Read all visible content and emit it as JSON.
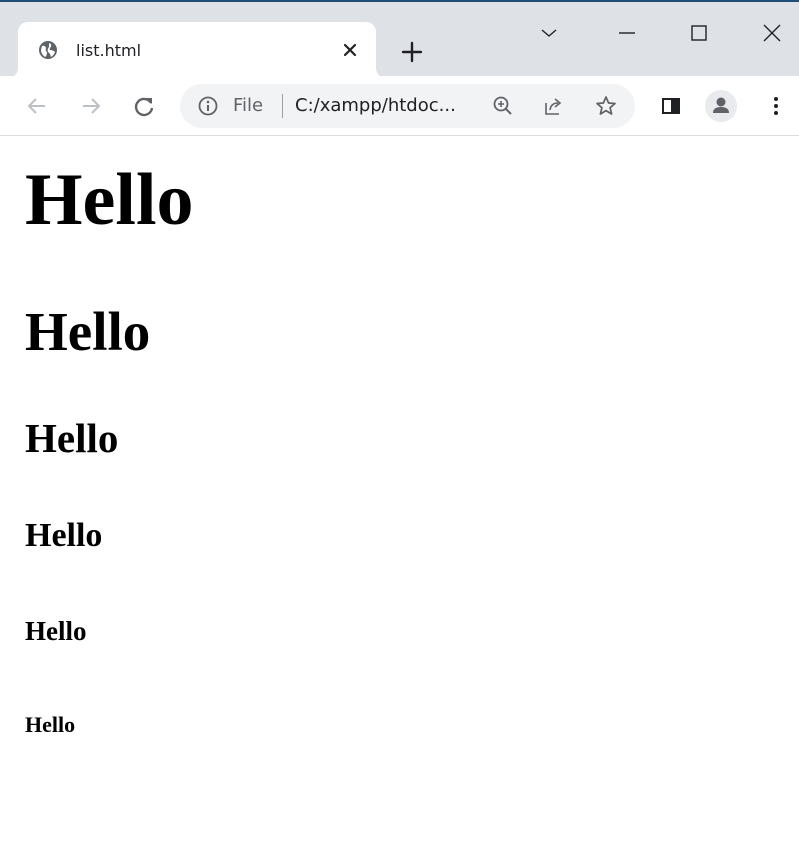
{
  "browser": {
    "tab": {
      "title": "list.html",
      "favicon": "globe-icon"
    },
    "window_controls": [
      "chevron-down-icon",
      "minimize-icon",
      "maximize-icon",
      "close-icon"
    ],
    "address_bar": {
      "site_label": "File",
      "url_display": "C:/xampp/htdoc..."
    },
    "colors": {
      "chrome_bg": "#dee1e6",
      "omnibox_bg": "#f1f3f4",
      "icon": "#5f6368"
    }
  },
  "page": {
    "headings": [
      {
        "level": 1,
        "text": "Hello"
      },
      {
        "level": 2,
        "text": "Hello"
      },
      {
        "level": 3,
        "text": "Hello"
      },
      {
        "level": 4,
        "text": "Hello"
      },
      {
        "level": 5,
        "text": "Hello"
      },
      {
        "level": 6,
        "text": "Hello"
      }
    ]
  }
}
